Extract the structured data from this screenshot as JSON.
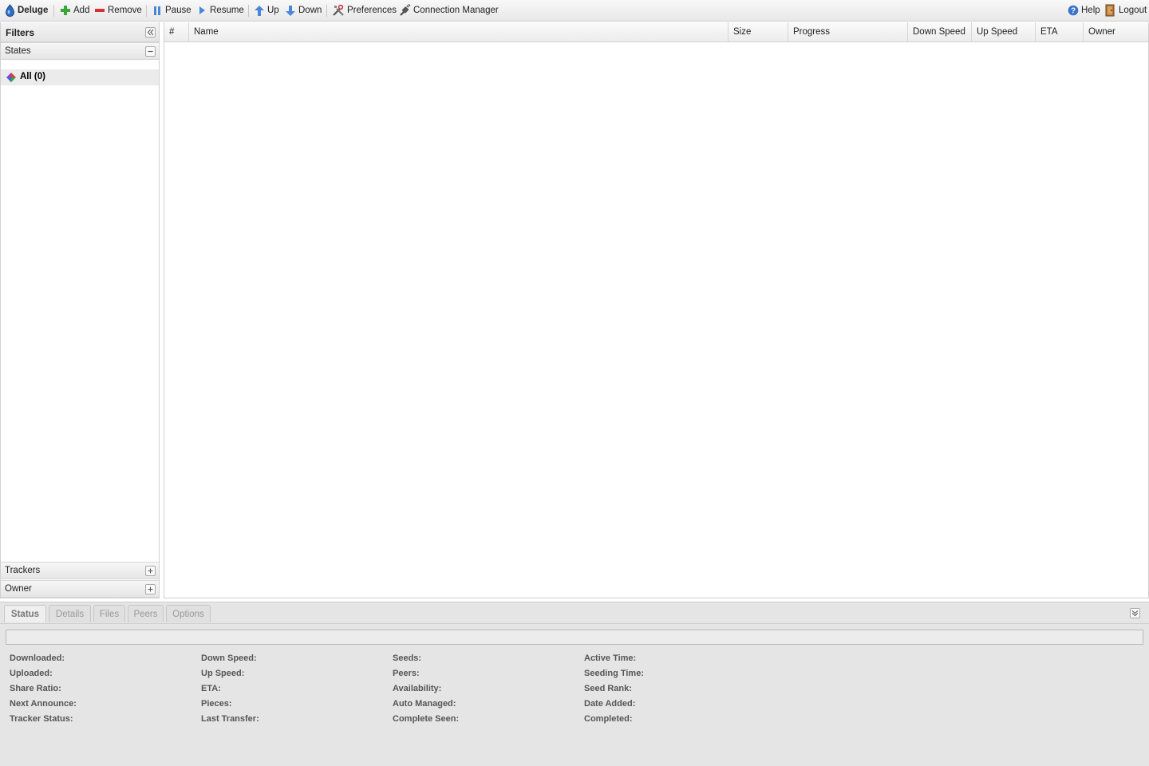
{
  "toolbar": {
    "brand": "Deluge",
    "add": "Add",
    "remove": "Remove",
    "pause": "Pause",
    "resume": "Resume",
    "up": "Up",
    "down": "Down",
    "preferences": "Preferences",
    "connection_manager": "Connection Manager",
    "help": "Help",
    "logout": "Logout"
  },
  "sidebar": {
    "title": "Filters",
    "states_label": "States",
    "all_state": "All (0)",
    "trackers_label": "Trackers",
    "owner_label": "Owner"
  },
  "grid": {
    "columns": [
      "#",
      "Name",
      "Size",
      "Progress",
      "Down Speed",
      "Up Speed",
      "ETA",
      "Owner"
    ]
  },
  "details": {
    "tabs": [
      "Status",
      "Details",
      "Files",
      "Peers",
      "Options"
    ],
    "active_tab": "Status",
    "fields": {
      "col1": [
        "Downloaded:",
        "Uploaded:",
        "Share Ratio:",
        "Next Announce:",
        "Tracker Status:"
      ],
      "col2": [
        "Down Speed:",
        "Up Speed:",
        "ETA:",
        "Pieces:",
        "Last Transfer:"
      ],
      "col3": [
        "Seeds:",
        "Peers:",
        "Availability:",
        "Auto Managed:",
        "Complete Seen:"
      ],
      "col4": [
        "Active Time:",
        "Seeding Time:",
        "Seed Rank:",
        "Date Added:",
        "Completed:"
      ]
    }
  },
  "colors": {
    "toolbar_bg": "#efefef",
    "panel_bg": "#e5e5e5",
    "icon_blue": "#2e6fd6",
    "icon_green": "#3aa63a",
    "icon_red": "#d83030"
  }
}
